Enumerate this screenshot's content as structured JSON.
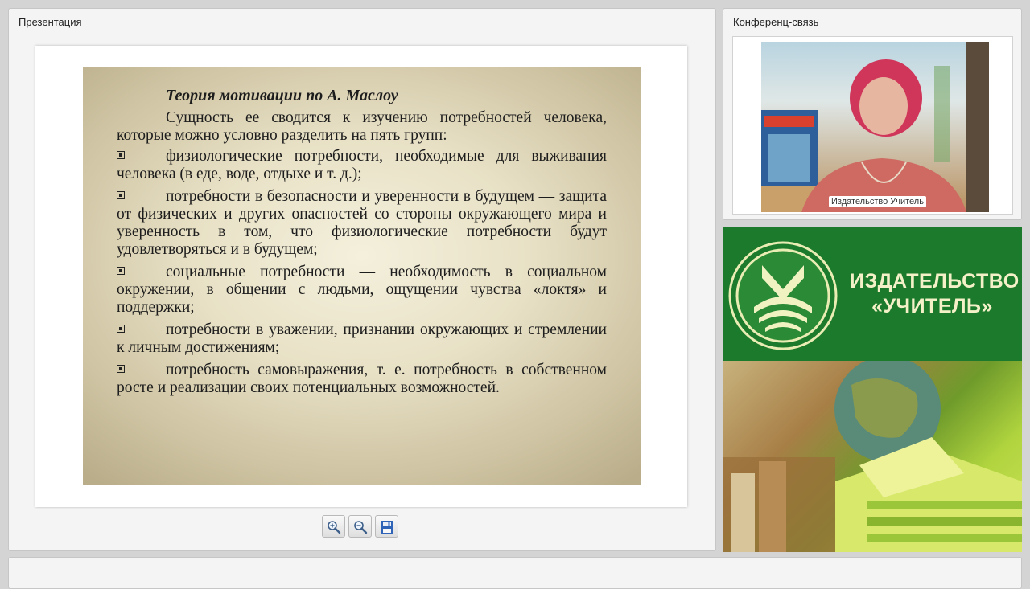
{
  "presentation": {
    "panel_title": "Презентация",
    "slide": {
      "title": "Теория мотивации по А. Маслоу",
      "intro": "Сущность ее сводится к изучению потребностей человека, которые можно условно разделить на пять групп:",
      "items": [
        "физиологические потребности, необходимые для выживания человека (в еде, воде, отдыхе и т. д.);",
        "потребности в безопасности и уверенности в будущем — защита от физических и других опасностей со стороны окружающего мира и уверенность в том, что физиологические потребности будут удовлетворяться и в будущем;",
        "социальные потребности — необходимость в социальном окружении, в общении с людьми, ощущении чувства «локтя» и поддержки;",
        "потребности в уважении, признании окружающих и стремлении к личным достижениям;",
        "потребность самовыражения, т. е. потребность в собственном росте и реализации своих потенциальных возможностей."
      ]
    },
    "toolbar": {
      "zoom_in_icon": "zoom-in-icon",
      "zoom_out_icon": "zoom-out-icon",
      "save_icon": "save-icon"
    }
  },
  "conference": {
    "panel_title": "Конференц-связь",
    "speaker_label": "Издательство Учитель"
  },
  "branding": {
    "publisher_line1": "ИЗДАТЕЛЬСТВО",
    "publisher_line2": "«УЧИТЕЛЬ»"
  },
  "colors": {
    "brand_green": "#1c7a2c",
    "brand_text": "#f4f1c8"
  }
}
